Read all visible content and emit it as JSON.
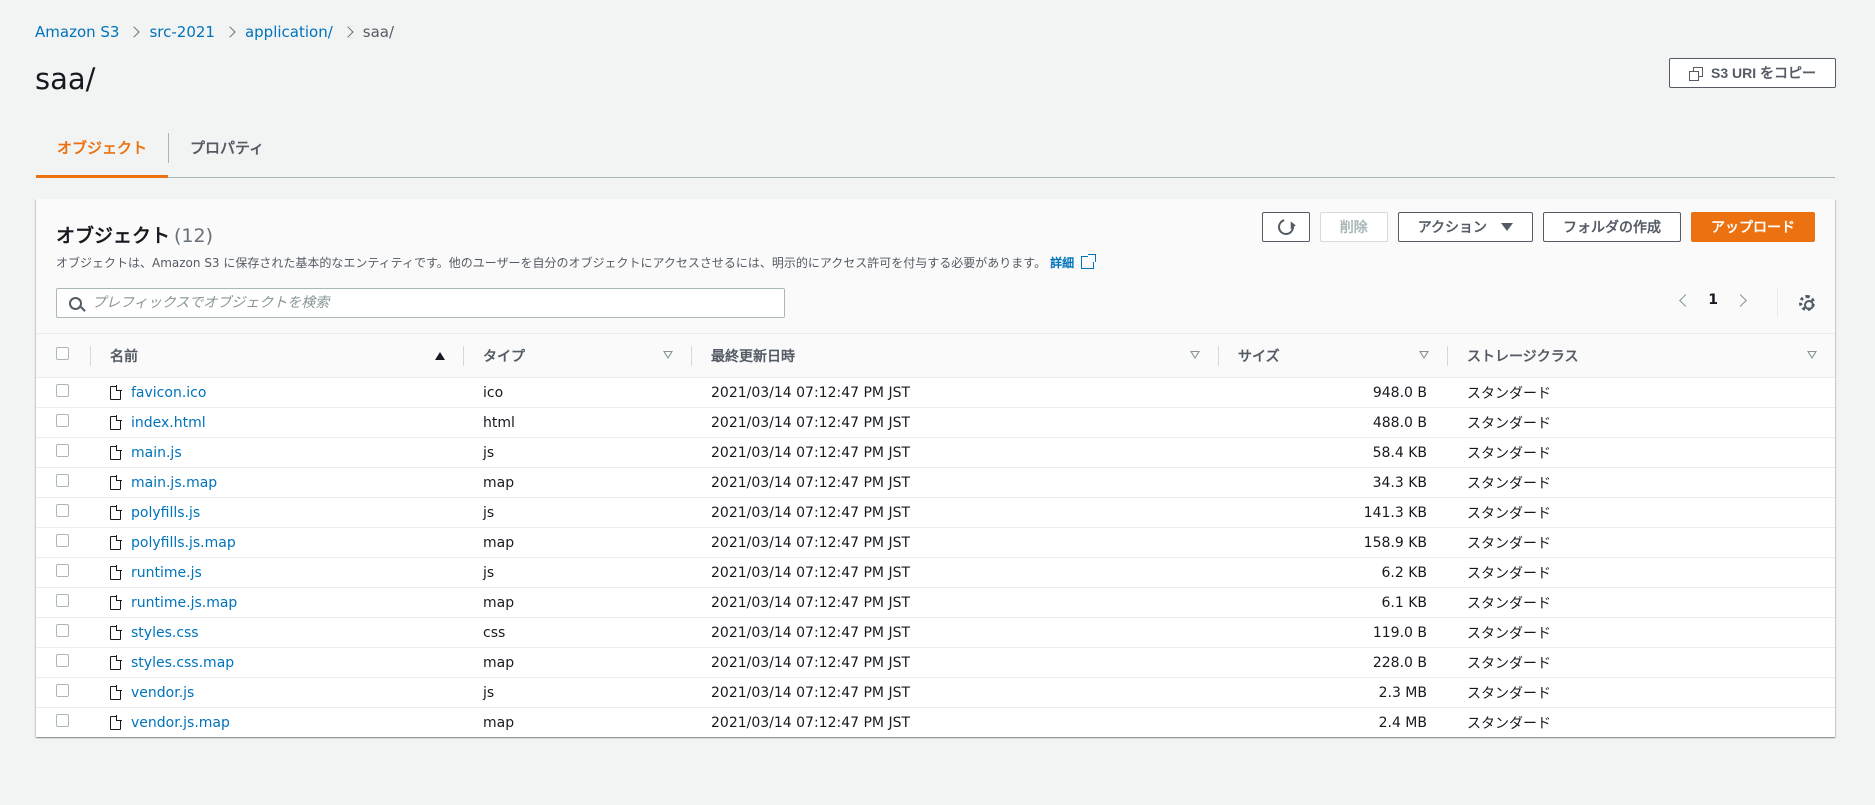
{
  "breadcrumb": {
    "items": [
      "Amazon S3",
      "src-2021",
      "application/",
      "saa/"
    ]
  },
  "page": {
    "title": "saa/",
    "copy_uri_label": "S3 URI をコピー"
  },
  "tabs": [
    {
      "label": "オブジェクト",
      "active": true
    },
    {
      "label": "プロパティ",
      "active": false
    }
  ],
  "panel": {
    "title": "オブジェクト",
    "count": "(12)",
    "description": "オブジェクトは、Amazon S3 に保存された基本的なエンティティです。他のユーザーを自分のオブジェクトにアクセスさせるには、明示的にアクセス許可を付与する必要があります。",
    "details_link": "詳細",
    "buttons": {
      "delete": "削除",
      "actions": "アクション",
      "create_folder": "フォルダの作成",
      "upload": "アップロード"
    },
    "search_placeholder": "プレフィックスでオブジェクトを検索",
    "page_number": "1"
  },
  "table": {
    "columns": {
      "name": "名前",
      "type": "タイプ",
      "last_modified": "最終更新日時",
      "size": "サイズ",
      "storage_class": "ストレージクラス"
    },
    "rows": [
      {
        "name": "favicon.ico",
        "type": "ico",
        "date": "2021/03/14 07:12:47 PM JST",
        "size": "948.0 B",
        "storage": "スタンダード"
      },
      {
        "name": "index.html",
        "type": "html",
        "date": "2021/03/14 07:12:47 PM JST",
        "size": "488.0 B",
        "storage": "スタンダード"
      },
      {
        "name": "main.js",
        "type": "js",
        "date": "2021/03/14 07:12:47 PM JST",
        "size": "58.4 KB",
        "storage": "スタンダード"
      },
      {
        "name": "main.js.map",
        "type": "map",
        "date": "2021/03/14 07:12:47 PM JST",
        "size": "34.3 KB",
        "storage": "スタンダード"
      },
      {
        "name": "polyfills.js",
        "type": "js",
        "date": "2021/03/14 07:12:47 PM JST",
        "size": "141.3 KB",
        "storage": "スタンダード"
      },
      {
        "name": "polyfills.js.map",
        "type": "map",
        "date": "2021/03/14 07:12:47 PM JST",
        "size": "158.9 KB",
        "storage": "スタンダード"
      },
      {
        "name": "runtime.js",
        "type": "js",
        "date": "2021/03/14 07:12:47 PM JST",
        "size": "6.2 KB",
        "storage": "スタンダード"
      },
      {
        "name": "runtime.js.map",
        "type": "map",
        "date": "2021/03/14 07:12:47 PM JST",
        "size": "6.1 KB",
        "storage": "スタンダード"
      },
      {
        "name": "styles.css",
        "type": "css",
        "date": "2021/03/14 07:12:47 PM JST",
        "size": "119.0 B",
        "storage": "スタンダード"
      },
      {
        "name": "styles.css.map",
        "type": "map",
        "date": "2021/03/14 07:12:47 PM JST",
        "size": "228.0 B",
        "storage": "スタンダード"
      },
      {
        "name": "vendor.js",
        "type": "js",
        "date": "2021/03/14 07:12:47 PM JST",
        "size": "2.3 MB",
        "storage": "スタンダード"
      },
      {
        "name": "vendor.js.map",
        "type": "map",
        "date": "2021/03/14 07:12:47 PM JST",
        "size": "2.4 MB",
        "storage": "スタンダード"
      }
    ]
  },
  "colors": {
    "accent": "#ec7211",
    "link": "#0073bb",
    "background": "#f2f3f3"
  }
}
